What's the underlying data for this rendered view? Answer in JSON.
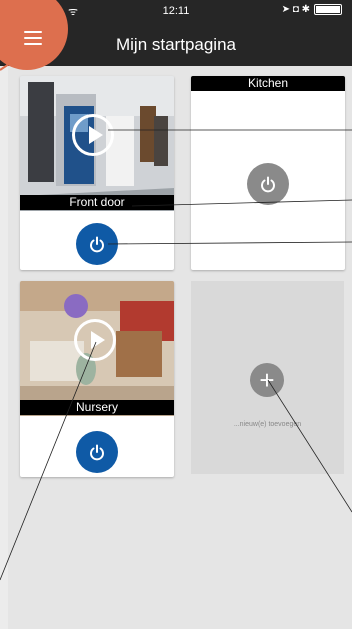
{
  "statusbar": {
    "signal": "●●●●●",
    "wifi": "ᯤ",
    "time": "12:11",
    "indicators": "➤ ◘ ✱"
  },
  "header": {
    "title": "Mijn startpagina"
  },
  "tiles": [
    {
      "label": "Front door"
    },
    {
      "label": "Kitchen"
    },
    {
      "label": "Nursery"
    }
  ],
  "add_tile": {
    "text": "...nieuw(e) toevoegen",
    "icon": "+"
  },
  "colors": {
    "accent": "#dd6f4e",
    "power_blue": "#0f5aa6",
    "header_bg": "#262626"
  }
}
